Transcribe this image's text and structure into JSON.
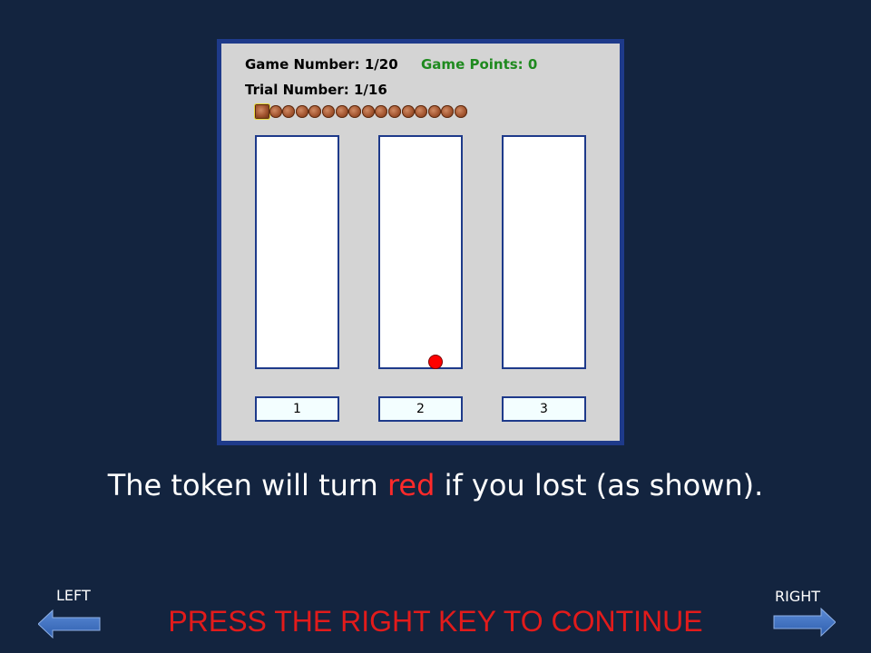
{
  "panel": {
    "game_number": "Game Number: 1/20",
    "game_points": "Game Points: 0",
    "trial_number": "Trial Number: 1/16",
    "tokens_total": 16,
    "current_token_index": 0,
    "points_color": "#1f8a1f",
    "token_color": "#a0522d",
    "lost_token_color": "#ff0000"
  },
  "columns": [
    {
      "label": "1",
      "has_red_token": false
    },
    {
      "label": "2",
      "has_red_token": true
    },
    {
      "label": "3",
      "has_red_token": false
    }
  ],
  "instruction": {
    "before": "The token will turn ",
    "highlight": "red",
    "after": " if you lost (as shown)."
  },
  "navigation": {
    "left_label": "LEFT",
    "right_label": "RIGHT",
    "left_icon": "left-arrow-icon",
    "right_icon": "right-arrow-icon",
    "continue_prompt": "PRESS THE RIGHT KEY TO CONTINUE"
  }
}
